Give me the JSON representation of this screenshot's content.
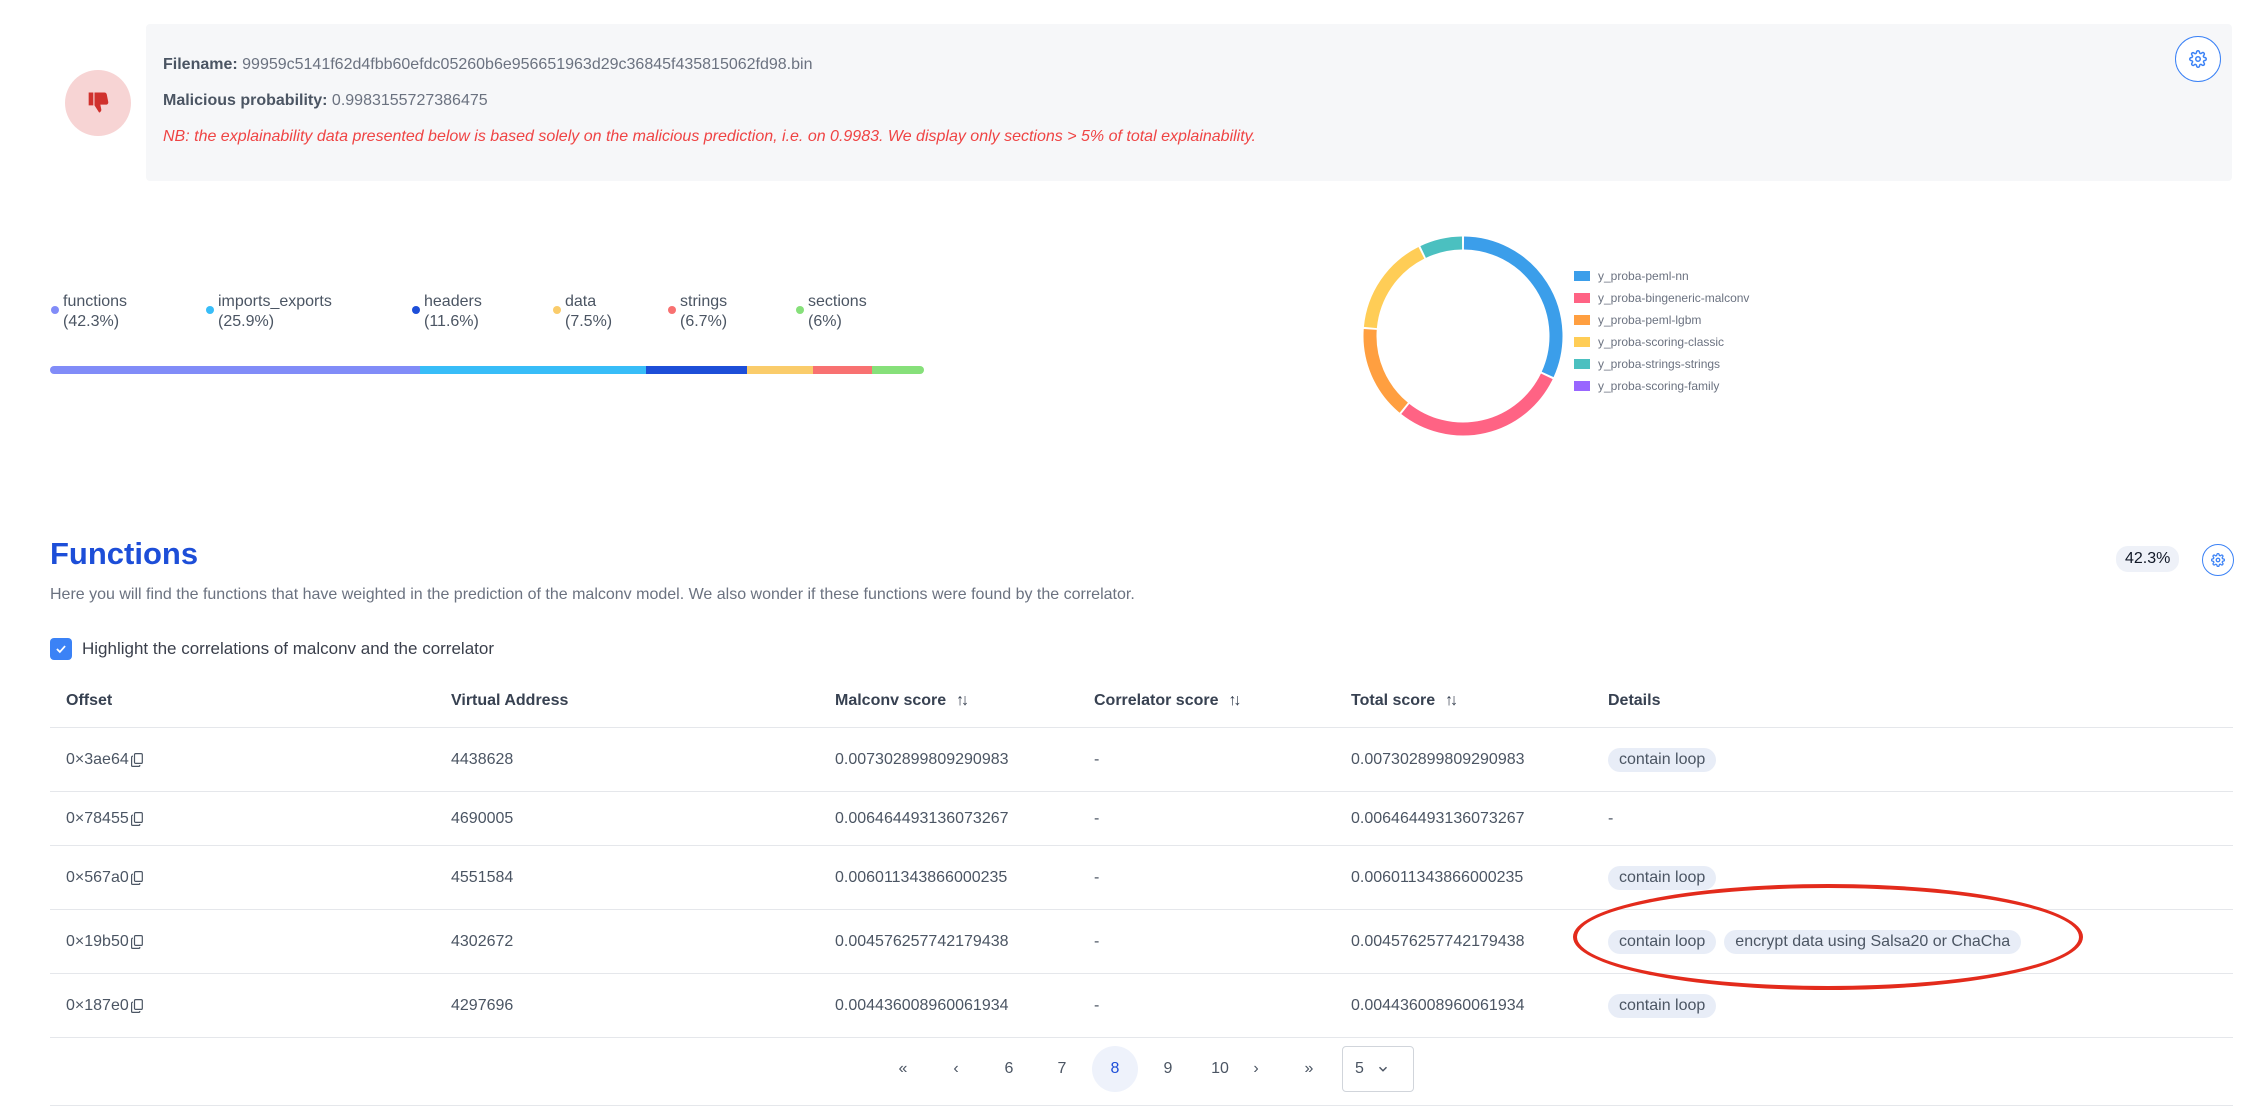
{
  "header": {
    "filename_label": "Filename:",
    "filename_value": "99959c5141f62d4fbb60efdc05260b6e956651963d29c36845f435815062fd98.bin",
    "probability_label": "Malicious probability:",
    "probability_value": "0.9983155727386475",
    "note": "NB: the explainability data presented below is based solely on the malicious prediction, i.e. on 0.9983. We display only sections > 5% of total explainability."
  },
  "categories": [
    {
      "name": "functions",
      "pct": "(42.3%)",
      "value": 42.3,
      "color": "#818cf8"
    },
    {
      "name": "imports_exports",
      "pct": "(25.9%)",
      "value": 25.9,
      "color": "#38bdf8"
    },
    {
      "name": "headers",
      "pct": "(11.6%)",
      "value": 11.6,
      "color": "#1d4ed8"
    },
    {
      "name": "data",
      "pct": "(7.5%)",
      "value": 7.5,
      "color": "#facc6b"
    },
    {
      "name": "strings",
      "pct": "(6.7%)",
      "value": 6.7,
      "color": "#f87171"
    },
    {
      "name": "sections",
      "pct": "(6%)",
      "value": 6,
      "color": "#86e07a"
    }
  ],
  "donut": {
    "series": [
      {
        "name": "y_proba-peml-nn",
        "value": 31,
        "color": "#3b9eea"
      },
      {
        "name": "y_proba-bingeneric-malconv",
        "value": 28,
        "color": "#ff6384"
      },
      {
        "name": "y_proba-peml-lgbm",
        "value": 15,
        "color": "#ff9f40"
      },
      {
        "name": "y_proba-scoring-classic",
        "value": 16,
        "color": "#ffcd56"
      },
      {
        "name": "y_proba-strings-strings",
        "value": 7,
        "color": "#4bc0c0"
      },
      {
        "name": "y_proba-scoring-family",
        "value": 0,
        "color": "#9966ff"
      }
    ]
  },
  "functions": {
    "title": "Functions",
    "description": "Here you will find the functions that have weighted in the prediction of the malconv model. We also wonder if these functions were found by the correlator.",
    "percent_badge": "42.3%",
    "checkbox_label": "Highlight the correlations of malconv and the correlator",
    "columns": {
      "offset": "Offset",
      "virtual_address": "Virtual Address",
      "malconv_score": "Malconv score",
      "correlator_score": "Correlator score",
      "total_score": "Total score",
      "details": "Details"
    },
    "rows": [
      {
        "offset": "0×3ae64",
        "va": "4438628",
        "malconv": "0.007302899809290983",
        "correlator": "-",
        "total": "0.007302899809290983",
        "details": [
          "contain loop"
        ],
        "details_text": ""
      },
      {
        "offset": "0×78455",
        "va": "4690005",
        "malconv": "0.006464493136073267",
        "correlator": "-",
        "total": "0.006464493136073267",
        "details": [],
        "details_text": "-"
      },
      {
        "offset": "0×567a0",
        "va": "4551584",
        "malconv": "0.006011343866000235",
        "correlator": "-",
        "total": "0.006011343866000235",
        "details": [
          "contain loop"
        ],
        "details_text": ""
      },
      {
        "offset": "0×19b50",
        "va": "4302672",
        "malconv": "0.004576257742179438",
        "correlator": "-",
        "total": "0.004576257742179438",
        "details": [
          "contain loop",
          "encrypt data using Salsa20 or ChaCha"
        ],
        "details_text": ""
      },
      {
        "offset": "0×187e0",
        "va": "4297696",
        "malconv": "0.004436008960061934",
        "correlator": "-",
        "total": "0.004436008960061934",
        "details": [
          "contain loop"
        ],
        "details_text": ""
      }
    ]
  },
  "pagination": {
    "first": "«",
    "prev": "‹",
    "pages": [
      "6",
      "7",
      "8",
      "9",
      "10"
    ],
    "active": "8",
    "next": "›",
    "last": "»",
    "page_size": "5"
  }
}
